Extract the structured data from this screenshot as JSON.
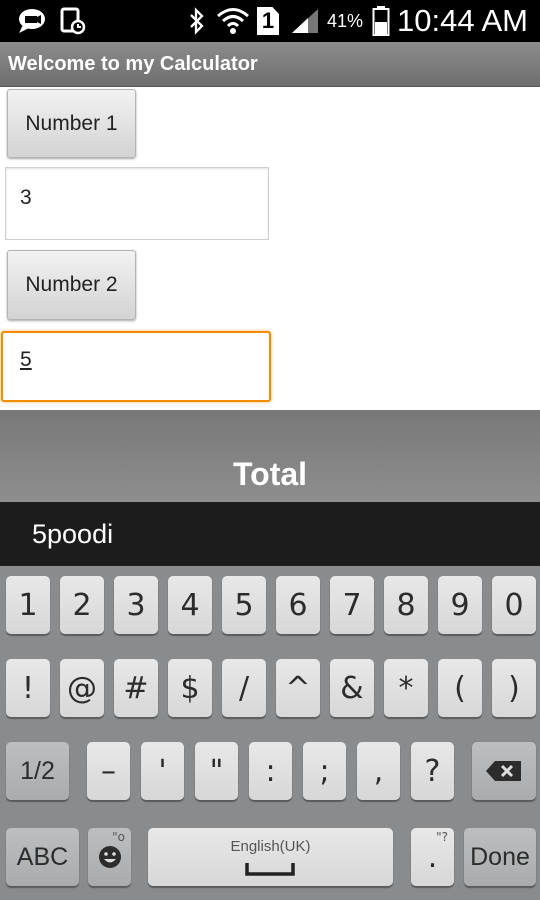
{
  "status_bar": {
    "time": "10:44 AM",
    "battery_percent": "41%",
    "sim_slot": "1",
    "icons": [
      "chat-icon",
      "screenshot-icon",
      "bluetooth-icon",
      "wifi-icon",
      "sim-icon",
      "signal-icon",
      "battery-icon"
    ]
  },
  "app": {
    "title": "Welcome to my Calculator"
  },
  "form": {
    "button1_label": "Number 1",
    "input1_value": "3",
    "button2_label": "Number 2",
    "input2_value": "5",
    "total_label": "Total"
  },
  "keyboard": {
    "suggestion": "5poodi",
    "row1": [
      "1",
      "2",
      "3",
      "4",
      "5",
      "6",
      "7",
      "8",
      "9",
      "0"
    ],
    "row2": [
      "!",
      "@",
      "#",
      "$",
      "/",
      "^",
      "&",
      "*",
      "(",
      ")"
    ],
    "row3": [
      "1/2",
      "–",
      "'",
      "\"",
      ":",
      ";",
      ",",
      "?"
    ],
    "abc_label": "ABC",
    "space_label": "English(UK)",
    "period_label": ".",
    "period_hint": "\"?",
    "emoji_hint": "\"o",
    "done_label": "Done",
    "accent_color": "#f28c00"
  }
}
